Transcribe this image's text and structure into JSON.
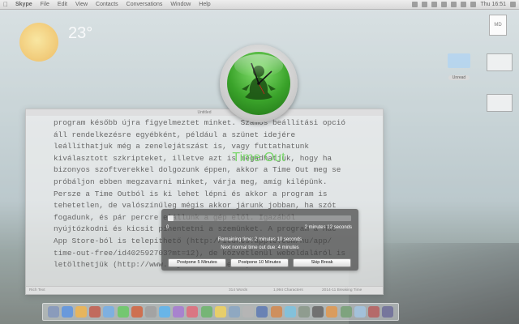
{
  "menubar": {
    "app_name": "Skype",
    "items": [
      "File",
      "Edit",
      "View",
      "Contacts",
      "Conversations",
      "Window",
      "Help"
    ],
    "clock": "Thu 16:51"
  },
  "desktop": {
    "weather": {
      "temperature": "23°"
    },
    "doc_icon_label": "MD",
    "folder_badge": "Unread"
  },
  "editor": {
    "title": "Untitled",
    "lines": [
      "program később újra figyelmeztet minket. Számos beállítási opció",
      "áll rendelkezésre egyébként, például a szünet idejére",
      "leállíthatjuk még a zenelejátszást is, vagy futtathatunk",
      "kiválasztott szkripteket, illetve azt is megadhatjuk, hogy ha",
      "bizonyos szoftverekkel dolgozunk éppen, akkor a Time Out meg se",
      "próbáljon ebben megzavarni minket, várja meg, amíg kilépünk.",
      "Persze a Time Outból is ki lehet lépni és akkor a program is",
      "tehetetlen, de valószínűleg mégis akkor járunk jobban, ha szót",
      "fogadunk, és pár percre elállunk a gép elől. Igazából",
      "nyújtózkodni és kicsit pihentetni a szemünket. A program a Mac",
      "App Store-ból is telepíthető (http://itunes.apple.com/hu/app/",
      "time-out-free/id402592703?mt=12), de közvetlenül weboldaláról is",
      "letölthetjük (http://www.dejal.com/timeout)"
    ],
    "status": {
      "left": "Rich Text",
      "middle": "314 Words",
      "middle2": "1,994 Characters",
      "right": "2014-11 Breaking Time"
    }
  },
  "break_overlay": {
    "app_title": "Time Out",
    "progress": {
      "fraction": 0.03,
      "start_label": "0",
      "end_label": "2 minutes 12 seconds"
    },
    "remaining_text": "Remaining time: 2 minutes 10 seconds",
    "next_timeout_text": "Next normal time out due: 4 minutes",
    "buttons": {
      "postpone5": "Postpone 5 Minutes",
      "postpone10": "Postpone 10 Minutes",
      "skip": "Skip Break"
    }
  },
  "dock": {
    "icon_colors": [
      "#6a7fa8",
      "#3f7dd1",
      "#e0a030",
      "#b04030",
      "#5a9ad8",
      "#4cb848",
      "#c04820",
      "#8a8a8a",
      "#3fa0e0",
      "#9060c0",
      "#d05060",
      "#50a050",
      "#e0c040",
      "#7090b0",
      "#a0a0a0",
      "#3f5f9f",
      "#c07030",
      "#60b0d0",
      "#708070",
      "#4a4a4a",
      "#d08030",
      "#5a8a5a",
      "#8ab0d0",
      "#a04040",
      "#505080"
    ]
  }
}
